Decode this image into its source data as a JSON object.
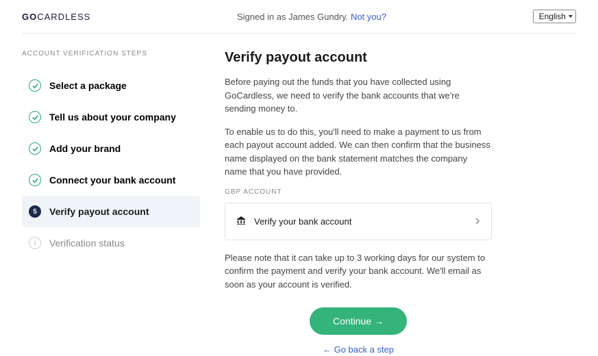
{
  "header": {
    "logo_bold": "GO",
    "logo_light": "CARDLESS",
    "signed_in_prefix": "Signed in as ",
    "user_name": "James Gundry.",
    "not_you": "Not you?",
    "language": "English"
  },
  "sidebar": {
    "heading": "ACCOUNT VERIFICATION STEPS",
    "steps": [
      {
        "label": "Select a package",
        "state": "done"
      },
      {
        "label": "Tell us about your company",
        "state": "done"
      },
      {
        "label": "Add your brand",
        "state": "done"
      },
      {
        "label": "Connect your bank account",
        "state": "done"
      },
      {
        "number": "5",
        "label": "Verify payout account",
        "state": "current"
      },
      {
        "label": "Verification status",
        "state": "upcoming"
      }
    ]
  },
  "main": {
    "title": "Verify payout account",
    "para1": "Before paying out the funds that you have collected using GoCardless, we need to verify the bank accounts that we're sending money to.",
    "para2": "To enable us to do this, you'll need to make a payment to us from each payout account added. We can then confirm that the business name displayed on the bank statement matches the company name that you have provided.",
    "account_label": "GBP ACCOUNT",
    "verify_card_label": "Verify your bank account",
    "para3": "Please note that it can take up to 3 working days for our system to confirm the payment and verify your bank account. We'll email as soon as your account is verified.",
    "continue_label": "Continue →",
    "go_back_label": "← Go back a step"
  },
  "colors": {
    "accent_green": "#34b37a",
    "link_blue": "#3a5fcd",
    "navy": "#1e2a4a"
  }
}
